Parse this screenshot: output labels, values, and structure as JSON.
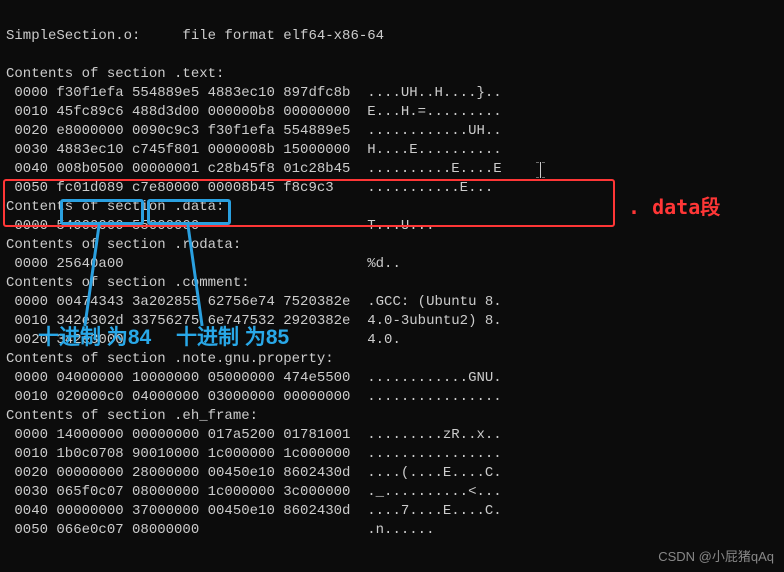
{
  "header": "SimpleSection.o:     file format elf64-x86-64",
  "sections": {
    "text": {
      "title": "Contents of section .text:",
      "rows": [
        " 0000 f30f1efa 554889e5 4883ec10 897dfc8b  ....UH..H....}..",
        " 0010 45fc89c6 488d3d00 000000b8 00000000  E...H.=.........",
        " 0020 e8000000 0090c9c3 f30f1efa 554889e5  ............UH..",
        " 0030 4883ec10 c745f801 0000008b 15000000  H....E..........",
        " 0040 008b0500 00000001 c28b45f8 01c28b45  ..........E....E",
        " 0050 fc01d089 c7e80000 00008b45 f8c9c3    ...........E..."
      ]
    },
    "data": {
      "title": "Contents of section .data:",
      "rows": [
        " 0000 54000000 55000000                    T...U..."
      ]
    },
    "rodata": {
      "title": "Contents of section .rodata:",
      "rows": [
        " 0000 25640a00                             %d.."
      ]
    },
    "comment": {
      "title": "Contents of section .comment:",
      "rows": [
        " 0000 00474343 3a202855 62756e74 7520382e  .GCC: (Ubuntu 8.",
        " 0010 342e302d 33756275 6e747532 2920382e  4.0-3ubuntu2) 8.",
        " 0020 342e3000                             4.0."
      ]
    },
    "property": {
      "title": "Contents of section .note.gnu.property:",
      "rows": [
        " 0000 04000000 10000000 05000000 474e5500  ............GNU.",
        " 0010 020000c0 04000000 03000000 00000000  ................"
      ]
    },
    "ehframe": {
      "title": "Contents of section .eh_frame:",
      "rows": [
        " 0000 14000000 00000000 017a5200 01781001  .........zR..x..",
        " 0010 1b0c0708 90010000 1c000000 1c000000  ................",
        " 0020 00000000 28000000 00450e10 8602430d  ....(....E....C.",
        " 0030 065f0c07 08000000 1c000000 3c000000  ._..........<...",
        " 0040 00000000 37000000 00450e10 8602430d  ....7....E....C.",
        " 0050 066e0c07 08000000                    .n......"
      ]
    }
  },
  "annotations": {
    "hex1_label": "十进制\n为84",
    "hex2_label": "十进制\n为85",
    "data_label": ". data段"
  },
  "watermark": "CSDN @小屁猪qAq"
}
